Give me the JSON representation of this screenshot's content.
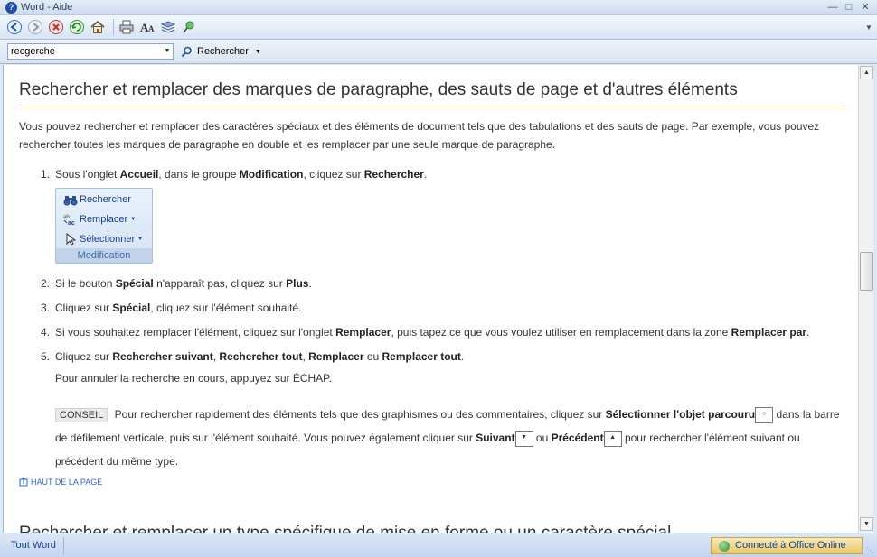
{
  "window": {
    "title": "Word - Aide"
  },
  "toolbar": {
    "buttons": [
      "back-icon",
      "forward-icon",
      "stop-icon",
      "refresh-icon",
      "home-icon",
      "print-icon",
      "font-size-icon",
      "table-of-contents-icon",
      "pin-icon"
    ]
  },
  "search": {
    "value": "recgerche",
    "button_label": "Rechercher"
  },
  "article": {
    "title": "Rechercher et remplacer des marques de paragraphe, des sauts de page et d'autres éléments",
    "intro_line1": "Vous pouvez rechercher et remplacer des caractères spéciaux et des éléments de document tels que des tabulations et des sauts de page. Par exemple, vous pouvez",
    "intro_line2": "rechercher toutes les marques de paragraphe en double et les remplacer par une seule marque de paragraphe.",
    "steps": [
      {
        "num": "1.",
        "parts": [
          "Sous l'onglet ",
          "Accueil",
          ", dans le groupe ",
          "Modification",
          ", cliquez sur ",
          "Rechercher",
          "."
        ]
      },
      {
        "num": "2.",
        "parts": [
          "Si le bouton ",
          "Spécial",
          " n'apparaît pas, cliquez sur ",
          "Plus",
          "."
        ]
      },
      {
        "num": "3.",
        "parts": [
          "Cliquez sur ",
          "Spécial",
          ", cliquez sur l'élément souhaité."
        ]
      },
      {
        "num": "4.",
        "parts": [
          "Si vous souhaitez remplacer l'élément, cliquez sur l'onglet ",
          "Remplacer",
          ", puis tapez ce que vous voulez utiliser en remplacement dans la zone ",
          "Remplacer par",
          "."
        ]
      },
      {
        "num": "5.",
        "parts": [
          "Cliquez sur ",
          "Rechercher suivant",
          ", ",
          "Rechercher tout",
          ", ",
          "Remplacer",
          " ou ",
          "Remplacer tout",
          "."
        ]
      }
    ],
    "ribbon": {
      "find_label": "Rechercher",
      "replace_label": "Remplacer",
      "select_label": "Sélectionner",
      "group_label": "Modification"
    },
    "cancel_text": "Pour annuler la recherche en cours, appuyez sur ÉCHAP.",
    "tip": {
      "label": "CONSEIL",
      "t1": "Pour rechercher rapidement des éléments tels que des graphismes ou des ",
      "link": "commentaires",
      "t2": ", cliquez sur ",
      "b1": "Sélectionner l'objet parcouru",
      "t3": " dans la barre",
      "t4": "de défilement verticale, puis sur l'élément souhaité. Vous pouvez également cliquer sur ",
      "b2": "Suivant",
      "t5": " ou ",
      "b3": "Précédent",
      "t6": " pour rechercher l'élément suivant ou",
      "t7": "précédent du même type."
    },
    "back_to_top": "HAUT DE LA PAGE",
    "next_heading": "Rechercher et remplacer un type spécifique de mise en forme ou un caractère spécial"
  },
  "status": {
    "left": "Tout Word",
    "right": "Connecté à Office Online"
  }
}
